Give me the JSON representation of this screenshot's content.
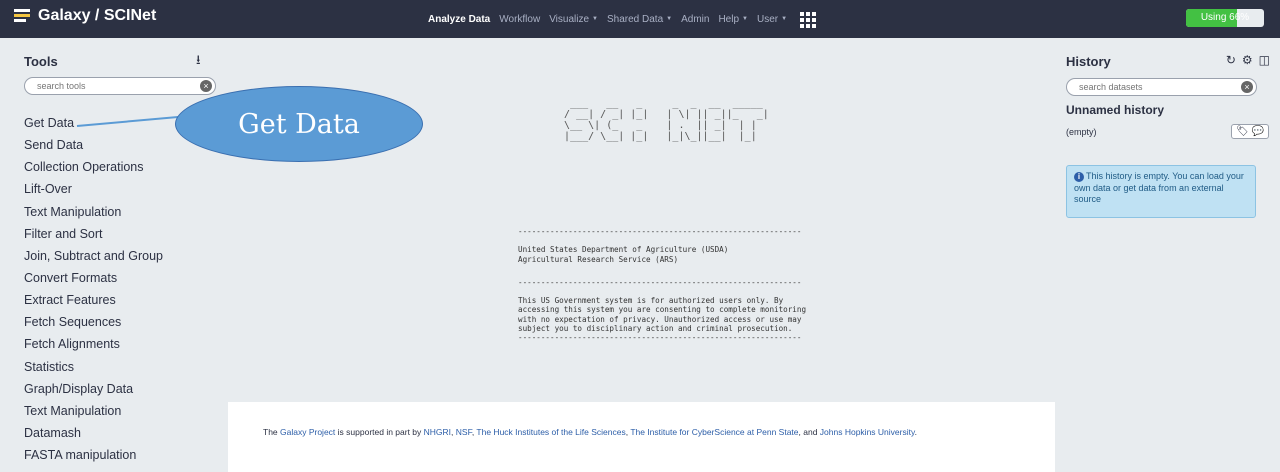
{
  "app": {
    "title": "Galaxy / SCINet",
    "usage_label": "Using 66%",
    "usage_fraction": 0.66
  },
  "nav": {
    "items": [
      {
        "label": "Analyze Data",
        "active": true,
        "caret": false
      },
      {
        "label": "Workflow",
        "active": false,
        "caret": false
      },
      {
        "label": "Visualize",
        "active": false,
        "caret": true
      },
      {
        "label": "Shared Data",
        "active": false,
        "caret": true
      },
      {
        "label": "Admin",
        "active": false,
        "caret": false
      },
      {
        "label": "Help",
        "active": false,
        "caret": true
      },
      {
        "label": "User",
        "active": false,
        "caret": true
      }
    ],
    "caret_glyph": "▼",
    "apps_icon": "grid-icon"
  },
  "tools": {
    "title": "Tools",
    "search_placeholder": "search tools",
    "sections": [
      "Get Data",
      "Send Data",
      "Collection Operations",
      "Lift-Over",
      "Text Manipulation",
      "Filter and Sort",
      "Join, Subtract and Group",
      "Convert Formats",
      "Extract Features",
      "Fetch Sequences",
      "Fetch Alignments",
      "Statistics",
      "Graph/Display Data",
      "Text Manipulation",
      "Datamash",
      "FASTA manipulation"
    ]
  },
  "center": {
    "ascii_logo": "    ___   __   _     _  _  __  _____\n   / __| / _| |_|   | \\| || _||_   _|\n   \\__ \\| (_   _    | .  || _|  | |\n   |___/ \\__| |_|   |_|\\_||__|  |_|",
    "divider": "--------------------------------------------------------------",
    "usda_line1": "United States Department of Agriculture (USDA)",
    "usda_line2": "Agricultural Research Service (ARS)",
    "warning_lines": [
      "This US Government system is for authorized users only. By",
      "accessing this system you are consenting to complete monitoring",
      "with no expectation of privacy. Unauthorized access or use may",
      "subject you to disciplinary action and criminal prosecution."
    ],
    "footer": {
      "pre": "The ",
      "galaxy_link": "Galaxy Project",
      "mid1": " is supported in part by ",
      "nhgri": "NHGRI",
      "sep1": ", ",
      "nsf": "NSF",
      "sep2": ", ",
      "huck": "The Huck Institutes of the Life Sciences",
      "sep3": ", ",
      "icds": "The Institute for CyberScience at Penn State",
      "mid2": ", and ",
      "jhu": "Johns Hopkins University",
      "end": "."
    }
  },
  "history": {
    "title": "History",
    "search_placeholder": "search datasets",
    "name": "Unnamed history",
    "size": "(empty)",
    "info": "This history is empty. You can load your own data or get data from an external source",
    "icons": [
      "refresh-icon",
      "gear-icon",
      "columns-icon"
    ]
  },
  "annotation": {
    "label": "Get Data",
    "color": "#5b9bd5"
  }
}
